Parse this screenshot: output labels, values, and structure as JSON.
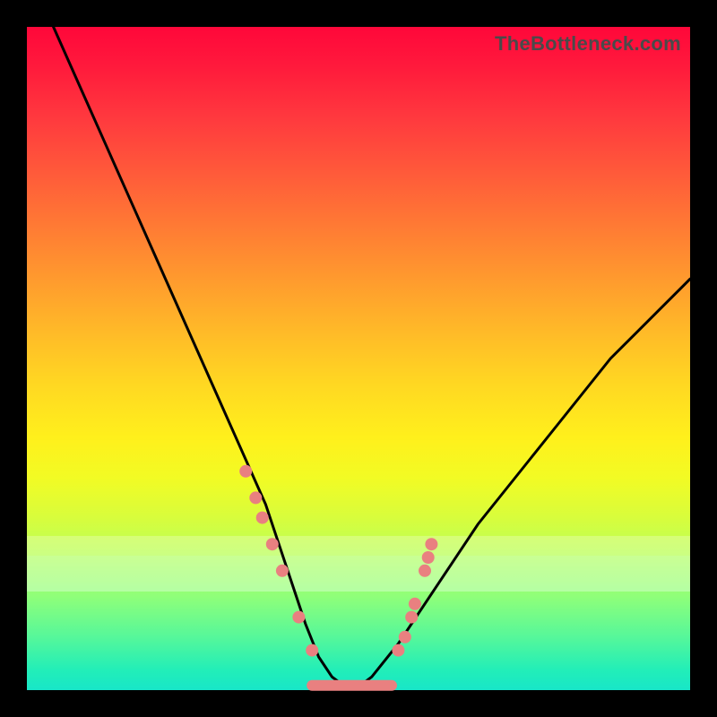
{
  "watermark": "TheBottleneck.com",
  "chart_data": {
    "type": "line",
    "title": "",
    "xlabel": "",
    "ylabel": "",
    "xlim": [
      0,
      100
    ],
    "ylim": [
      0,
      100
    ],
    "legend": false,
    "grid": false,
    "series": [
      {
        "name": "bottleneck-curve",
        "x": [
          4,
          8,
          12,
          16,
          20,
          24,
          28,
          32,
          36,
          38,
          40,
          42,
          44,
          46,
          48,
          50,
          52,
          56,
          60,
          64,
          68,
          72,
          76,
          80,
          84,
          88,
          92,
          96,
          100
        ],
        "y": [
          100,
          91,
          82,
          73,
          64,
          55,
          46,
          37,
          28,
          22,
          16,
          10,
          5,
          2,
          0.5,
          0.5,
          2,
          7,
          13,
          19,
          25,
          30,
          35,
          40,
          45,
          50,
          54,
          58,
          62
        ]
      }
    ],
    "markers": {
      "name": "sample-dots",
      "color": "#e98080",
      "points": [
        {
          "x": 33,
          "y": 33
        },
        {
          "x": 34.5,
          "y": 29
        },
        {
          "x": 35.5,
          "y": 26
        },
        {
          "x": 37,
          "y": 22
        },
        {
          "x": 38.5,
          "y": 18
        },
        {
          "x": 41,
          "y": 11
        },
        {
          "x": 43,
          "y": 6
        },
        {
          "x": 56,
          "y": 6
        },
        {
          "x": 57,
          "y": 8
        },
        {
          "x": 58,
          "y": 11
        },
        {
          "x": 58.5,
          "y": 13
        },
        {
          "x": 60,
          "y": 18
        },
        {
          "x": 60.5,
          "y": 20
        },
        {
          "x": 61,
          "y": 22
        }
      ]
    },
    "flat_bottom": {
      "name": "valley-segment",
      "color": "#e98080",
      "x0": 43,
      "x1": 55,
      "y": 0.7
    },
    "highlight_band": {
      "y0": 15,
      "y1": 23
    }
  }
}
